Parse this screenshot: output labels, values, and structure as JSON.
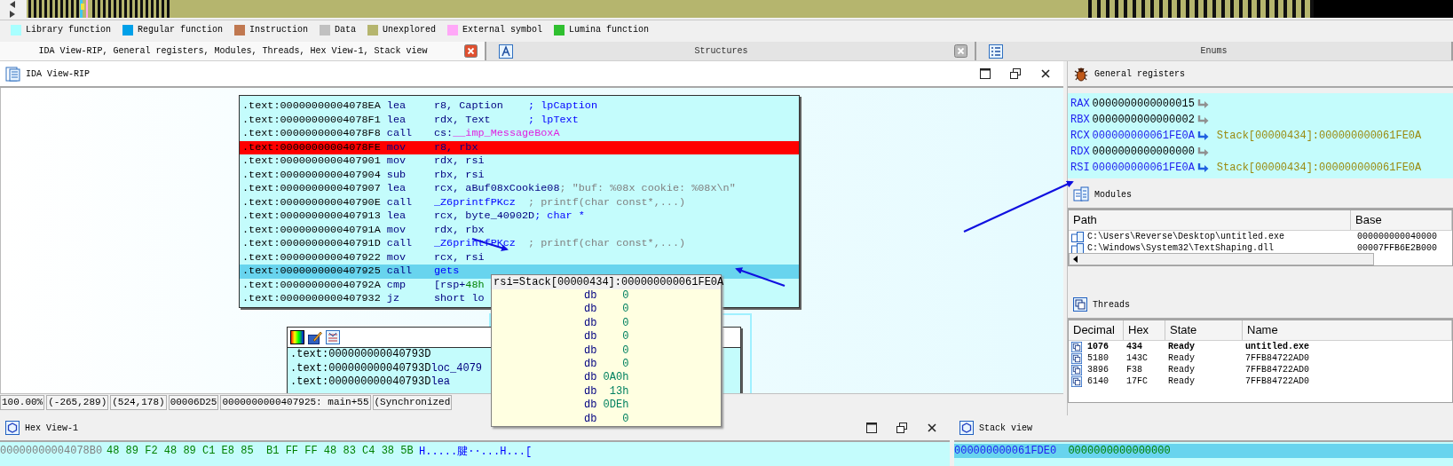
{
  "legend": [
    {
      "label": "Library function",
      "color": "#a8ffff"
    },
    {
      "label": "Regular function",
      "color": "#00a0e8"
    },
    {
      "label": "Instruction",
      "color": "#c07850"
    },
    {
      "label": "Data",
      "color": "#c0c0c0"
    },
    {
      "label": "Unexplored",
      "color": "#b5b56e"
    },
    {
      "label": "External symbol",
      "color": "#ffa8f8"
    },
    {
      "label": "Lumina function",
      "color": "#30c030"
    }
  ],
  "tabs": [
    {
      "label": "IDA View-RIP, General registers, Modules, Threads, Hex View-1, Stack view",
      "selected": true,
      "closable": true
    },
    {
      "label": "Structures",
      "selected": false,
      "closable": true
    },
    {
      "label": "Enums",
      "selected": false,
      "closable": false
    }
  ],
  "ida_view": {
    "title": "IDA View-RIP",
    "listing": [
      {
        "address": ".text:00000000004078EA",
        "mnemonic": "lea",
        "operands": [
          {
            "text": "r8, Caption",
            "kind": "plain"
          }
        ],
        "comment": {
          "text": "; lpCaption",
          "kind": "type"
        },
        "breakpoint": false,
        "selected": false
      },
      {
        "address": ".text:00000000004078F1",
        "mnemonic": "lea",
        "operands": [
          {
            "text": "rdx, Text",
            "kind": "plain"
          }
        ],
        "comment": {
          "text": "; lpText",
          "kind": "type"
        },
        "breakpoint": false,
        "selected": false
      },
      {
        "address": ".text:00000000004078F8",
        "mnemonic": "call",
        "operands": [
          {
            "text": "cs:",
            "kind": "plain"
          },
          {
            "text": "__imp_MessageBoxA",
            "kind": "import"
          }
        ],
        "breakpoint": false,
        "selected": false
      },
      {
        "address": ".text:00000000004078FE",
        "mnemonic": "mov",
        "operands": [
          {
            "text": "r8, rbx",
            "kind": "plain"
          }
        ],
        "breakpoint": true,
        "selected": false
      },
      {
        "address": ".text:0000000000407901",
        "mnemonic": "mov",
        "operands": [
          {
            "text": "rdx, rsi",
            "kind": "plain"
          }
        ],
        "breakpoint": false,
        "selected": false
      },
      {
        "address": ".text:0000000000407904",
        "mnemonic": "sub",
        "operands": [
          {
            "text": "rbx, rsi",
            "kind": "plain"
          }
        ],
        "breakpoint": false,
        "selected": false
      },
      {
        "address": ".text:0000000000407907",
        "mnemonic": "lea",
        "operands": [
          {
            "text": "rcx, aBuf08xCookie08",
            "kind": "plain"
          }
        ],
        "comment": {
          "text": "; \"buf: %08x cookie: %08x\\n\"",
          "kind": "auto"
        },
        "breakpoint": false,
        "selected": false
      },
      {
        "address": ".text:000000000040790E",
        "mnemonic": "call",
        "operands": [
          {
            "text": "_Z6printfPKcz",
            "kind": "name"
          }
        ],
        "comment": {
          "text": "; printf(char const*,...)",
          "kind": "auto"
        },
        "breakpoint": false,
        "selected": false
      },
      {
        "address": ".text:0000000000407913",
        "mnemonic": "lea",
        "operands": [
          {
            "text": "rcx, byte_40902D",
            "kind": "plain"
          }
        ],
        "comment": {
          "text": "; char *",
          "kind": "type"
        },
        "breakpoint": false,
        "selected": false
      },
      {
        "address": ".text:000000000040791A",
        "mnemonic": "mov",
        "operands": [
          {
            "text": "rdx, rbx",
            "kind": "plain"
          }
        ],
        "breakpoint": false,
        "selected": false
      },
      {
        "address": ".text:000000000040791D",
        "mnemonic": "call",
        "operands": [
          {
            "text": "_Z6printfPKcz",
            "kind": "name"
          }
        ],
        "comment": {
          "text": "; printf(char const*,...)",
          "kind": "auto"
        },
        "breakpoint": false,
        "selected": false
      },
      {
        "address": ".text:0000000000407922",
        "mnemonic": "mov",
        "operands": [
          {
            "text": "rcx, rsi",
            "kind": "plain"
          }
        ],
        "breakpoint": false,
        "selected": false
      },
      {
        "address": ".text:0000000000407925",
        "mnemonic": "call",
        "operands": [
          {
            "text": "gets",
            "kind": "name"
          }
        ],
        "breakpoint": false,
        "selected": true
      },
      {
        "address": ".text:000000000040792A",
        "mnemonic": "cmp",
        "operands": [
          {
            "text": "[rsp+",
            "kind": "plain"
          },
          {
            "text": "48h",
            "kind": "number"
          }
        ],
        "breakpoint": false,
        "selected": false
      },
      {
        "address": ".text:0000000000407932",
        "mnemonic": "jz",
        "operands": [
          {
            "text": "short lo",
            "kind": "plain"
          }
        ],
        "breakpoint": false,
        "selected": false
      }
    ],
    "graph_node": {
      "lines": [
        {
          "address": ".text:000000000040793D"
        },
        {
          "address": ".text:000000000040793D",
          "text": "loc_4079"
        },
        {
          "address": ".text:000000000040793D",
          "text": "lea"
        }
      ]
    },
    "tooltip": {
      "title": "rsi=Stack[00000434]:000000000061FE0A",
      "rows": [
        {
          "directive": "db",
          "value": "0"
        },
        {
          "directive": "db",
          "value": "0"
        },
        {
          "directive": "db",
          "value": "0"
        },
        {
          "directive": "db",
          "value": "0"
        },
        {
          "directive": "db",
          "value": "0"
        },
        {
          "directive": "db",
          "value": "0"
        },
        {
          "directive": "db",
          "value": "0A0h"
        },
        {
          "directive": "db",
          "value": "13h"
        },
        {
          "directive": "db",
          "value": "0DEh"
        },
        {
          "directive": "db",
          "value": "0"
        }
      ]
    },
    "status_bar": [
      "100.00%",
      "(-265,289)",
      "(524,178)",
      "00006D25",
      "0000000000407925: main+55",
      "(Synchronized"
    ]
  },
  "registers": {
    "title": "General registers",
    "rows": [
      {
        "name": "RAX",
        "value": "0000000000000015",
        "kind": "value"
      },
      {
        "name": "RBX",
        "value": "0000000000000002",
        "kind": "value"
      },
      {
        "name": "RCX",
        "value": "000000000061FE0A",
        "kind": "pointer",
        "target": "Stack[00000434]:000000000061FE0A"
      },
      {
        "name": "RDX",
        "value": "0000000000000000",
        "kind": "value"
      },
      {
        "name": "RSI",
        "value": "000000000061FE0A",
        "kind": "pointer",
        "target": "Stack[00000434]:000000000061FE0A"
      }
    ]
  },
  "modules": {
    "title": "Modules",
    "columns": [
      "Path",
      "Base"
    ],
    "rows": [
      {
        "path": "C:\\Users\\Reverse\\Desktop\\untitled.exe",
        "base": "000000000040000"
      },
      {
        "path": "C:\\Windows\\System32\\TextShaping.dll",
        "base": "00007FFB6E2B000"
      }
    ]
  },
  "threads": {
    "title": "Threads",
    "columns": [
      "Decimal",
      "Hex",
      "State",
      "Name"
    ],
    "rows": [
      {
        "decimal": "1076",
        "hex": "434",
        "state": "Ready",
        "name": "untitled.exe",
        "current": true
      },
      {
        "decimal": "5180",
        "hex": "143C",
        "state": "Ready",
        "name": "7FFB84722AD0",
        "current": false
      },
      {
        "decimal": "3896",
        "hex": "F38",
        "state": "Ready",
        "name": "7FFB84722AD0",
        "current": false
      },
      {
        "decimal": "6140",
        "hex": "17FC",
        "state": "Ready",
        "name": "7FFB84722AD0",
        "current": false
      }
    ]
  },
  "hex_view": {
    "title": "Hex View-1",
    "rows": [
      {
        "address": "00000000004078B0",
        "bytes": "48 89 F2 48 89 C1 E8 85  B1 FF FF 48 83 C4 38 5B",
        "text": "H.....腱··...H...["
      }
    ]
  },
  "stack_view": {
    "title": "Stack view",
    "rows": [
      {
        "address": "000000000061FDE0",
        "value": "0000000000000000",
        "selected": true
      }
    ]
  }
}
